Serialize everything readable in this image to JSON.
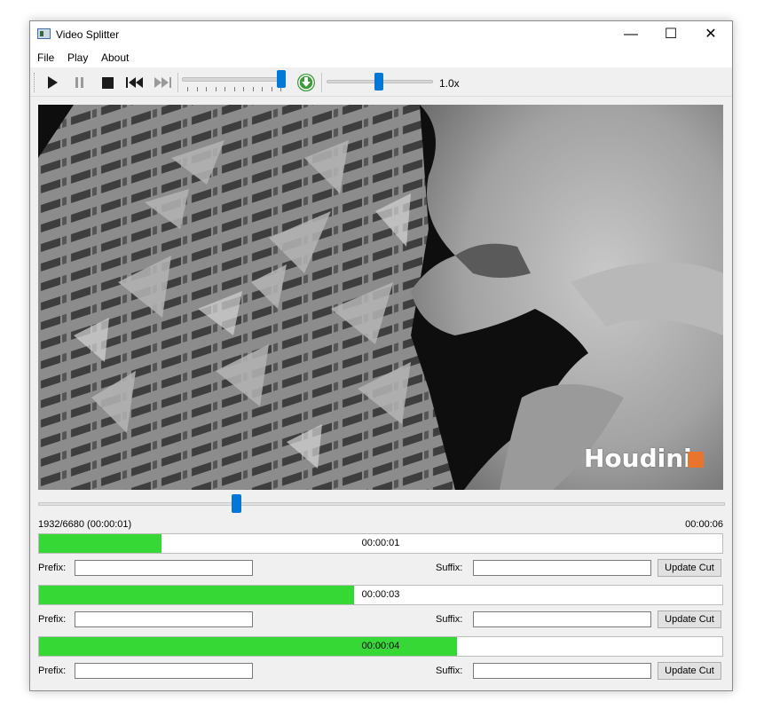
{
  "window": {
    "title": "Video Splitter",
    "minimize_glyph": "—",
    "maximize_glyph": "☐",
    "close_glyph": "✕"
  },
  "menu": [
    "File",
    "Play",
    "About"
  ],
  "toolbar": {
    "icons": [
      "play-icon",
      "pause-icon",
      "stop-icon",
      "skip-backward-icon",
      "skip-forward-icon",
      "download-icon"
    ],
    "volume_level": 1.0,
    "speed_label": "1.0x",
    "speed_level": 0.5
  },
  "video": {
    "watermark": "Houdini",
    "accent_color": "#e8742d"
  },
  "playback": {
    "frame_label": "1932/6680 (00:00:01)",
    "duration": "00:00:06",
    "position_fraction": 0.289
  },
  "colors": {
    "accent": "#0078d7",
    "progress": "#35d835"
  },
  "cuts": [
    {
      "time": "00:00:01",
      "fill_fraction": 0.179,
      "prefix_label": "Prefix:",
      "prefix_value": "",
      "suffix_label": "Suffix:",
      "suffix_value": "",
      "button": "Update Cut"
    },
    {
      "time": "00:00:03",
      "fill_fraction": 0.461,
      "prefix_label": "Prefix:",
      "prefix_value": "",
      "suffix_label": "Suffix:",
      "suffix_value": "",
      "button": "Update Cut"
    },
    {
      "time": "00:00:04",
      "fill_fraction": 0.612,
      "prefix_label": "Prefix:",
      "prefix_value": "",
      "suffix_label": "Suffix:",
      "suffix_value": "",
      "button": "Update Cut"
    }
  ]
}
